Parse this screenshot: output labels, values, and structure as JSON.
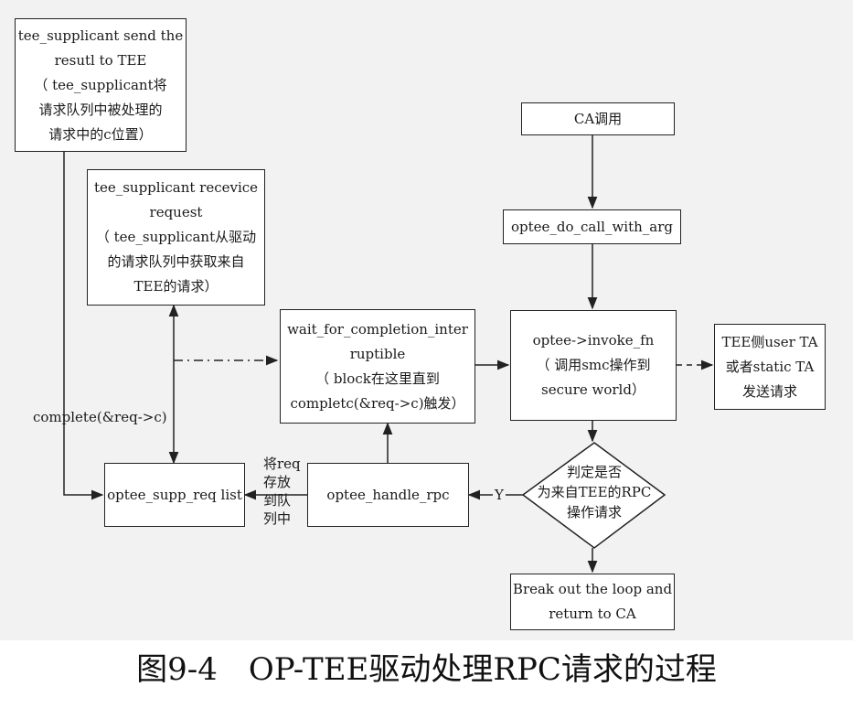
{
  "nodes": {
    "send_result": [
      "tee_supplicant send the",
      "resutl to TEE",
      "（ tee_supplicant将",
      "请求队列中被处理的",
      "请求中的c位置）"
    ],
    "receive_request": [
      "tee_supplicant recevice",
      "request",
      "（ tee_supplicant从驱动",
      "的请求队列中获取来自",
      "TEE的请求）"
    ],
    "ca_call": [
      "CA调用"
    ],
    "do_call_with_arg": [
      "optee_do_call_with_arg"
    ],
    "wait_for_completion": [
      "wait_for_completion_inter",
      "ruptible",
      "（ block在这里直到",
      "completc(&req->c)触发）"
    ],
    "invoke_fn": [
      "optee->invoke_fn",
      "（ 调用smc操作到",
      "secure world）"
    ],
    "tee_side": [
      "TEE侧user TA",
      "或者static TA",
      "发送请求"
    ],
    "supp_req_list": [
      "optee_supp_req list"
    ],
    "handle_rpc": [
      "optee_handle_rpc"
    ],
    "decision": [
      "判定是否",
      "为来自TEE的RPC",
      "操作请求"
    ],
    "break_out": [
      "Break out the loop and",
      "return to CA"
    ]
  },
  "edge_labels": {
    "complete": "complete(&req->c)",
    "store_queue": [
      "将req",
      "存放",
      "到队",
      "列中"
    ],
    "yes": "Y"
  },
  "caption": "图9-4　OP-TEE驱动处理RPC请求的过程"
}
